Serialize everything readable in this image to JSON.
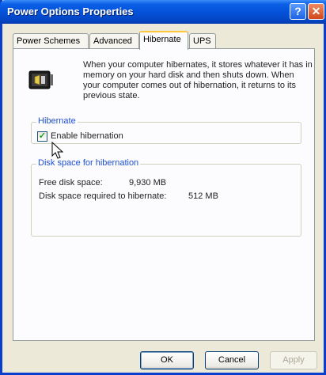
{
  "window": {
    "title": "Power Options Properties"
  },
  "titlebar": {
    "help_glyph": "?",
    "close_glyph": "✕"
  },
  "tabs": [
    {
      "label": "Power Schemes"
    },
    {
      "label": "Advanced"
    },
    {
      "label": "Hibernate",
      "active": true
    },
    {
      "label": "UPS"
    }
  ],
  "info": {
    "icon": "hibernate-icon",
    "text": "When your computer hibernates, it stores whatever it has in memory on your hard disk and then shuts down. When your computer comes out of hibernation, it returns to its previous state."
  },
  "hibernate_group": {
    "label": "Hibernate",
    "checkbox_label": "Enable hibernation",
    "checked": true
  },
  "disk_group": {
    "label": "Disk space for hibernation",
    "free_label": "Free disk space:",
    "free_value": "9,930 MB",
    "required_label": "Disk space required to hibernate:",
    "required_value": "512 MB"
  },
  "buttons": {
    "ok": "OK",
    "cancel": "Cancel",
    "apply": "Apply"
  },
  "colors": {
    "title_bar": "#0450d8",
    "close": "#d2461a",
    "tab_accent": "#ffc83c",
    "group_label": "#1e4fd0"
  }
}
